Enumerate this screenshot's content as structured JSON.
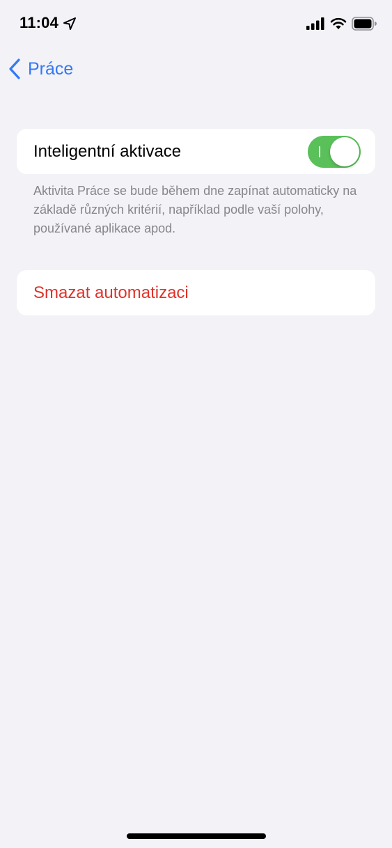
{
  "status_bar": {
    "time": "11:04",
    "icons": [
      "location-arrow-icon",
      "cellular-signal-icon",
      "wifi-icon",
      "battery-icon"
    ]
  },
  "nav": {
    "back_label": "Práce",
    "back_icon": "chevron-left-icon"
  },
  "smart_activation": {
    "label": "Inteligentní aktivace",
    "enabled": true,
    "description": "Aktivita Práce se bude během dne zapínat automaticky na základě různých kritérií, například podle vaší polohy, používané aplikace apod."
  },
  "delete_automation": {
    "label": "Smazat automatizaci"
  },
  "colors": {
    "background": "#f2f2f7",
    "card": "#ffffff",
    "accent_blue": "#3478f6",
    "switch_on": "#5ac05a",
    "destructive_red": "#e0322a",
    "secondary_text": "#86868b"
  }
}
